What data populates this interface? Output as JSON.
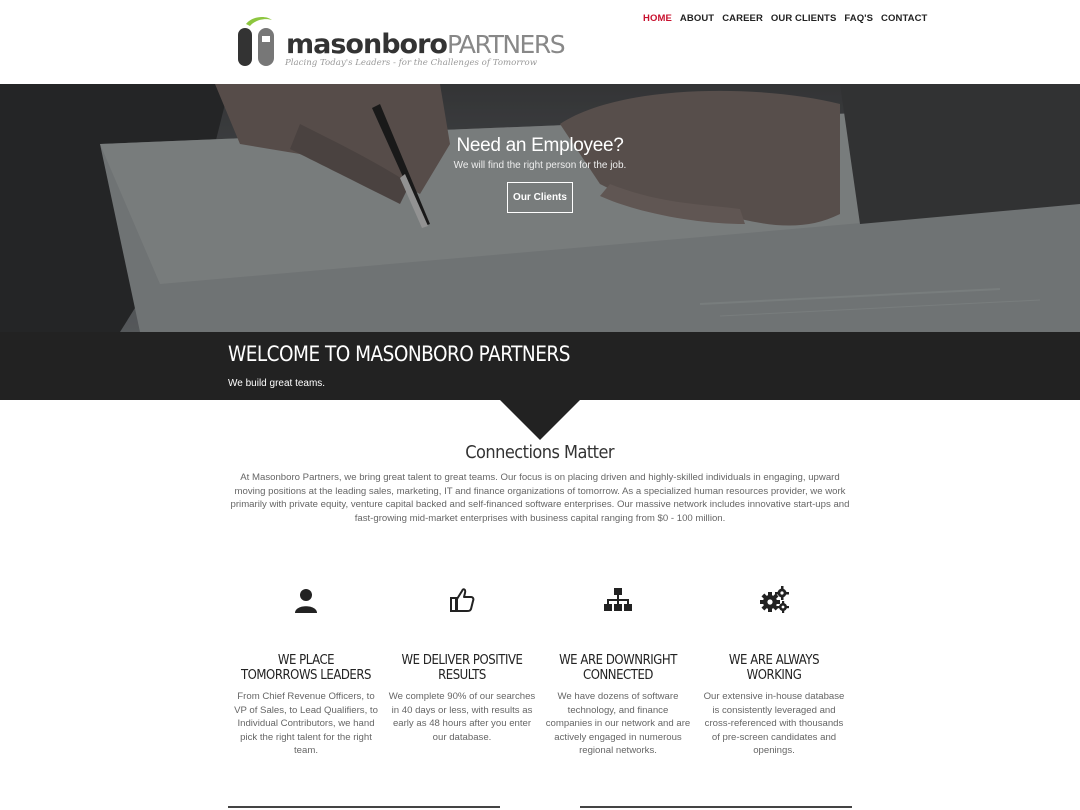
{
  "logo": {
    "word_main": "masonboro",
    "word_secondary": "PARTNERS",
    "tagline": "Placing Today's Leaders - for the Challenges of Tomorrow"
  },
  "nav": {
    "items": [
      {
        "label": "HOME",
        "active": true
      },
      {
        "label": "ABOUT",
        "active": false
      },
      {
        "label": "CAREER",
        "active": false
      },
      {
        "label": "OUR CLIENTS",
        "active": false
      },
      {
        "label": "FAQ'S",
        "active": false
      },
      {
        "label": "CONTACT",
        "active": false
      }
    ]
  },
  "hero": {
    "title": "Need an Employee?",
    "subtitle": "We will find the right person for the job.",
    "button_label": "Our Clients"
  },
  "welcome": {
    "title": "WELCOME TO MASONBORO PARTNERS",
    "subtitle": "We build great teams."
  },
  "connections": {
    "title": "Connections Matter",
    "body": "At Masonboro Partners, we bring great talent to great teams. Our focus is on placing driven and highly-skilled individuals in engaging, upward moving positions at the leading sales, marketing, IT and finance organizations of tomorrow. As a specialized human resources provider, we work primarily with private equity, venture capital backed and self-financed software enterprises. Our massive network includes innovative start-ups and fast-growing mid-market enterprises with business capital ranging from $0 - 100 million."
  },
  "features": [
    {
      "icon": "user-icon",
      "title": "WE PLACE TOMORROWS LEADERS",
      "text": "From Chief Revenue Officers, to VP of Sales, to Lead Qualifiers, to Individual Contributors, we hand pick the right talent for the right team."
    },
    {
      "icon": "thumbs-up-icon",
      "title": "WE DELIVER POSITIVE RESULTS",
      "text": "We complete 90% of our searches in 40 days or less, with results as early as 48 hours after you enter our database."
    },
    {
      "icon": "sitemap-icon",
      "title": "WE ARE DOWNRIGHT CONNECTED",
      "text": "We have dozens of software technology, and finance companies in our network and are actively engaged in numerous regional networks."
    },
    {
      "icon": "gears-icon",
      "title": "WE ARE ALWAYS WORKING",
      "text": "Our extensive in-house database is consistently leveraged and cross-referenced with thousands of pre-screen candidates and openings."
    }
  ],
  "colors": {
    "accent_red": "#c8102e",
    "dark_band": "#222222",
    "logo_green": "#8dc63f"
  }
}
